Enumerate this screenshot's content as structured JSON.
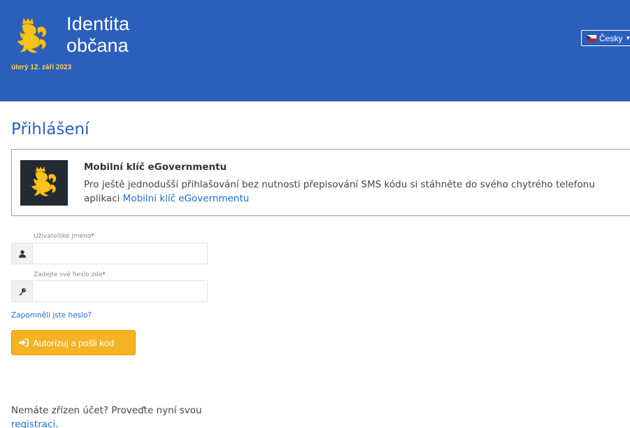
{
  "header": {
    "brand_line1": "Identita",
    "brand_line2": "občana",
    "date": "úterý 12. září 2023",
    "language": "Česky",
    "logo_icon": "lion-crest-icon"
  },
  "page": {
    "title": "Přihlášení"
  },
  "info": {
    "icon": "lion-crest-icon",
    "title": "Mobilní klíč eGovernmentu",
    "text": "Pro ještě jednodušší přihlašování bez nutnosti přepisování SMS kódu si stáhněte do svého chytrého telefonu aplikaci ",
    "link_text": "Mobilní klíč eGovernmentu"
  },
  "form": {
    "username_label": "Uživatelské jméno",
    "username_value": "",
    "password_label": "Zadejte své heslo zde",
    "password_value": "",
    "required_mark": "*",
    "forgot_link": "Zapomněli jste heslo?",
    "submit_label": "Autorizuj a pošli kód"
  },
  "footer": {
    "text": "Nemáte zřízen účet? Proveďte nyní svou ",
    "link_text": "registraci",
    "text_end": "."
  },
  "colors": {
    "header_bg": "#2b5fbb",
    "accent_yellow": "#f5b222",
    "link": "#1a6fd1",
    "date_yellow": "#ffd24a"
  }
}
